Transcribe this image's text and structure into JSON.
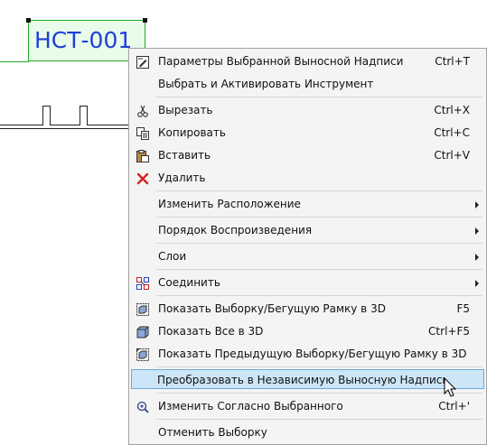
{
  "drawing": {
    "label_text": "НСТ-001"
  },
  "menu": {
    "items": [
      {
        "label": "Параметры Выбранной Выносной Надписи",
        "shortcut": "Ctrl+T",
        "icon": "label-settings-icon"
      },
      {
        "label": "Выбрать и Активировать Инструмент",
        "shortcut": "",
        "icon": ""
      },
      {
        "label": "Вырезать",
        "shortcut": "Ctrl+X",
        "icon": "scissors-icon"
      },
      {
        "label": "Копировать",
        "shortcut": "Ctrl+C",
        "icon": "copy-icon"
      },
      {
        "label": "Вставить",
        "shortcut": "Ctrl+V",
        "icon": "paste-icon"
      },
      {
        "label": "Удалить",
        "shortcut": "",
        "icon": "delete-icon"
      },
      {
        "label": "Изменить Расположение",
        "shortcut": "",
        "icon": ""
      },
      {
        "label": "Порядок Воспроизведения",
        "shortcut": "",
        "icon": ""
      },
      {
        "label": "Слои",
        "shortcut": "",
        "icon": ""
      },
      {
        "label": "Соединить",
        "shortcut": "",
        "icon": "connect-icon"
      },
      {
        "label": "Показать Выборку/Бегущую Рамку в 3D",
        "shortcut": "F5",
        "icon": "show-3d-selection-icon"
      },
      {
        "label": "Показать Все в 3D",
        "shortcut": "Ctrl+F5",
        "icon": "show-all-3d-icon"
      },
      {
        "label": "Показать Предыдущую Выборку/Бегущую Рамку в 3D",
        "shortcut": "",
        "icon": "show-previous-3d-icon"
      },
      {
        "label": "Преобразовать в Независимую Выносную Надпись",
        "shortcut": "",
        "icon": ""
      },
      {
        "label": "Изменить Согласно Выбранного",
        "shortcut": "Ctrl+'",
        "icon": "magic-wand-icon"
      },
      {
        "label": "Отменить Выборку",
        "shortcut": "",
        "icon": ""
      }
    ]
  },
  "colors": {
    "highlight": "#cde6f7",
    "label_text": "#1f3fd8",
    "label_border": "#22aa22",
    "delete_icon": "#d42020"
  }
}
